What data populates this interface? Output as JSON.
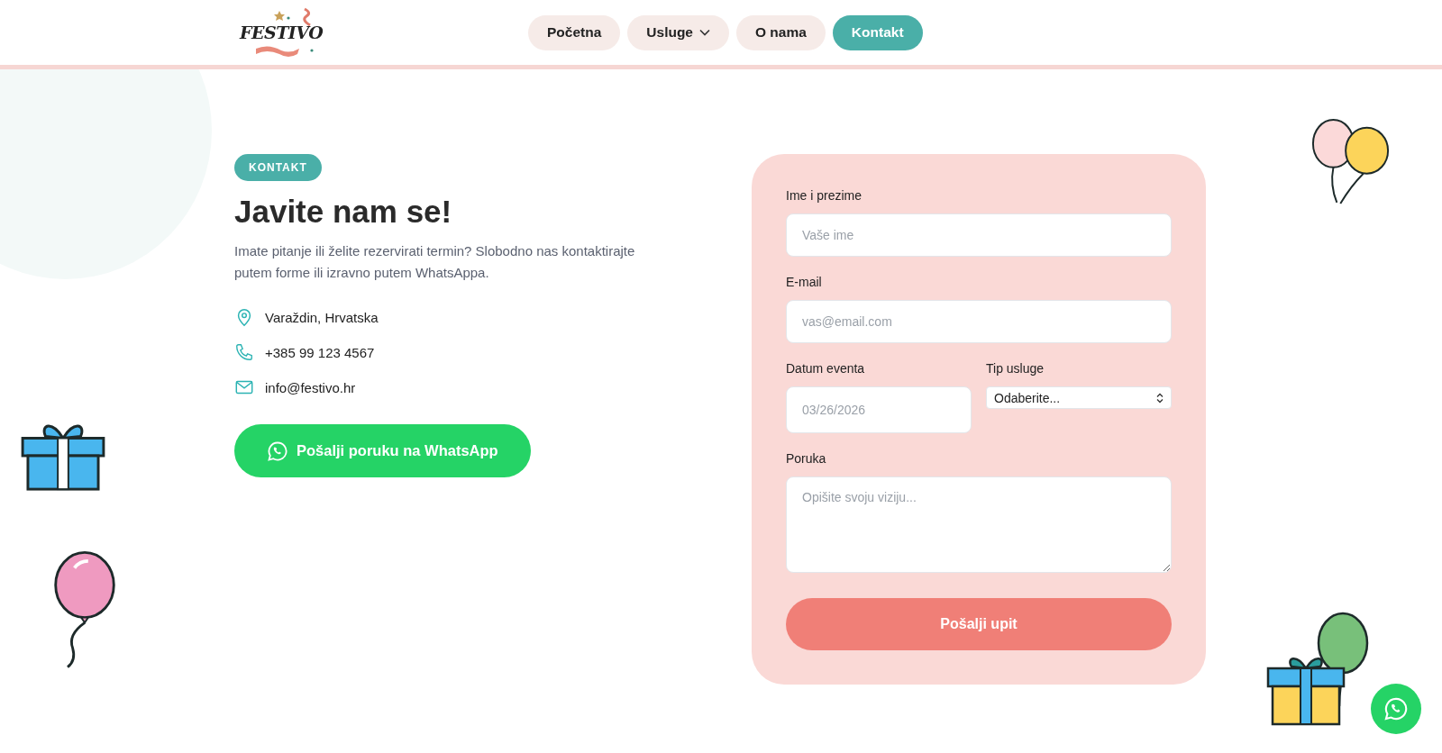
{
  "logo": {
    "text": "FESTIVO"
  },
  "nav": [
    {
      "label": "Početna",
      "selected": false,
      "kind": "link"
    },
    {
      "label": "Usluge",
      "selected": false,
      "kind": "dropdown"
    },
    {
      "label": "O nama",
      "selected": false,
      "kind": "link"
    },
    {
      "label": "Kontakt",
      "selected": true,
      "kind": "link"
    }
  ],
  "intro": {
    "badge": "KONTAKT",
    "title": "Javite nam se!",
    "text": "Imate pitanje ili želite rezervirati termin? Slobodno nas kontaktirajte putem forme ili izravno putem WhatsAppa."
  },
  "contacts": [
    {
      "kind": "location",
      "text": "Varaždin, Hrvatska"
    },
    {
      "kind": "phone",
      "text": "+385 99 123 4567"
    },
    {
      "kind": "email",
      "text": "info@festivo.hr"
    }
  ],
  "whatsapp_button": "Pošalji poruku na WhatsApp",
  "form": {
    "name": {
      "label": "Ime i prezime",
      "placeholder": "Vaše ime"
    },
    "email": {
      "label": "E-mail",
      "placeholder": "vas@email.com"
    },
    "date": {
      "label": "Datum eventa",
      "placeholder": "03/26/2026"
    },
    "service": {
      "label": "Tip usluge",
      "value": "Odaberite..."
    },
    "message": {
      "label": "Poruka",
      "placeholder": "Opišite svoju viziju..."
    },
    "submit": "Pošalji upit"
  }
}
